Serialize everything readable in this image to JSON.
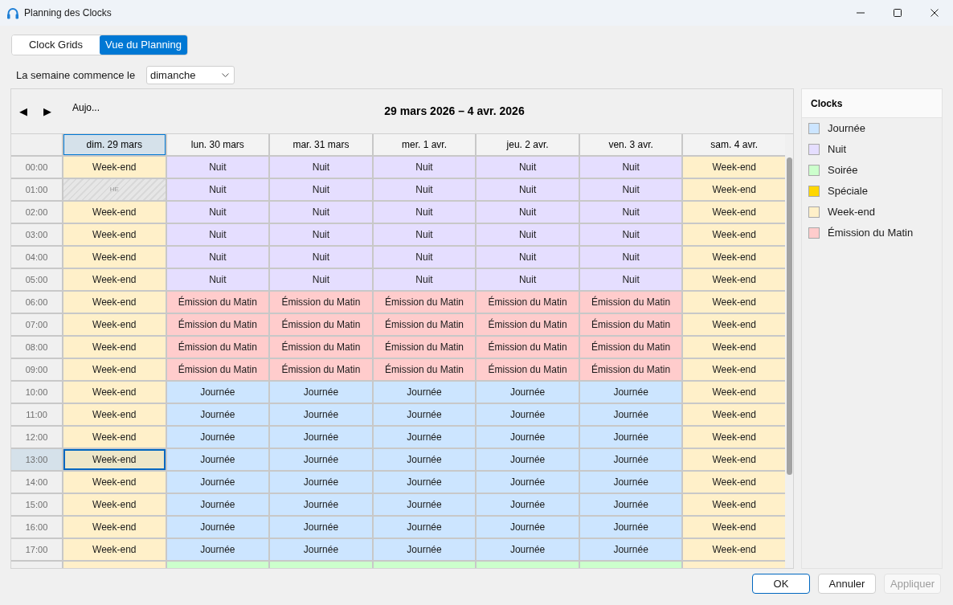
{
  "window": {
    "title": "Planning des Clocks"
  },
  "tabs": [
    {
      "label": "Clock Grids",
      "selected": false
    },
    {
      "label": "Vue du Planning",
      "selected": true
    }
  ],
  "week_start": {
    "label": "La semaine commence le",
    "value": "dimanche"
  },
  "calendar": {
    "prev_button": "◀",
    "next_button": "▶",
    "today_button": "Aujo...",
    "range_title": "29 mars 2026 – 4 avr. 2026",
    "days": [
      {
        "label": "dim. 29 mars",
        "selected": true
      },
      {
        "label": "lun. 30 mars",
        "selected": false
      },
      {
        "label": "mar. 31 mars",
        "selected": false
      },
      {
        "label": "mer. 1 avr.",
        "selected": false
      },
      {
        "label": "jeu. 2 avr.",
        "selected": false
      },
      {
        "label": "ven. 3 avr.",
        "selected": false
      },
      {
        "label": "sam. 4 avr.",
        "selected": false
      }
    ],
    "rows": [
      {
        "time": "00:00",
        "selected": false,
        "cells": [
          {
            "kind": "clock",
            "label": "Week-end",
            "color": "#fff0c9",
            "selected": false
          },
          {
            "kind": "clock",
            "label": "Nuit",
            "color": "#e5deff",
            "selected": false
          },
          {
            "kind": "clock",
            "label": "Nuit",
            "color": "#e5deff",
            "selected": false
          },
          {
            "kind": "clock",
            "label": "Nuit",
            "color": "#e5deff",
            "selected": false
          },
          {
            "kind": "clock",
            "label": "Nuit",
            "color": "#e5deff",
            "selected": false
          },
          {
            "kind": "clock",
            "label": "Nuit",
            "color": "#e5deff",
            "selected": false
          },
          {
            "kind": "clock",
            "label": "Week-end",
            "color": "#fff0c9",
            "selected": false
          }
        ]
      },
      {
        "time": "01:00",
        "selected": false,
        "cells": [
          {
            "kind": "empty",
            "label": "HE",
            "selected": false
          },
          {
            "kind": "clock",
            "label": "Nuit",
            "color": "#e5deff",
            "selected": false
          },
          {
            "kind": "clock",
            "label": "Nuit",
            "color": "#e5deff",
            "selected": false
          },
          {
            "kind": "clock",
            "label": "Nuit",
            "color": "#e5deff",
            "selected": false
          },
          {
            "kind": "clock",
            "label": "Nuit",
            "color": "#e5deff",
            "selected": false
          },
          {
            "kind": "clock",
            "label": "Nuit",
            "color": "#e5deff",
            "selected": false
          },
          {
            "kind": "clock",
            "label": "Week-end",
            "color": "#fff0c9",
            "selected": false
          }
        ]
      },
      {
        "time": "02:00",
        "selected": false,
        "cells": [
          {
            "kind": "clock",
            "label": "Week-end",
            "color": "#fff0c9",
            "selected": false
          },
          {
            "kind": "clock",
            "label": "Nuit",
            "color": "#e5deff",
            "selected": false
          },
          {
            "kind": "clock",
            "label": "Nuit",
            "color": "#e5deff",
            "selected": false
          },
          {
            "kind": "clock",
            "label": "Nuit",
            "color": "#e5deff",
            "selected": false
          },
          {
            "kind": "clock",
            "label": "Nuit",
            "color": "#e5deff",
            "selected": false
          },
          {
            "kind": "clock",
            "label": "Nuit",
            "color": "#e5deff",
            "selected": false
          },
          {
            "kind": "clock",
            "label": "Week-end",
            "color": "#fff0c9",
            "selected": false
          }
        ]
      },
      {
        "time": "03:00",
        "selected": false,
        "cells": [
          {
            "kind": "clock",
            "label": "Week-end",
            "color": "#fff0c9",
            "selected": false
          },
          {
            "kind": "clock",
            "label": "Nuit",
            "color": "#e5deff",
            "selected": false
          },
          {
            "kind": "clock",
            "label": "Nuit",
            "color": "#e5deff",
            "selected": false
          },
          {
            "kind": "clock",
            "label": "Nuit",
            "color": "#e5deff",
            "selected": false
          },
          {
            "kind": "clock",
            "label": "Nuit",
            "color": "#e5deff",
            "selected": false
          },
          {
            "kind": "clock",
            "label": "Nuit",
            "color": "#e5deff",
            "selected": false
          },
          {
            "kind": "clock",
            "label": "Week-end",
            "color": "#fff0c9",
            "selected": false
          }
        ]
      },
      {
        "time": "04:00",
        "selected": false,
        "cells": [
          {
            "kind": "clock",
            "label": "Week-end",
            "color": "#fff0c9",
            "selected": false
          },
          {
            "kind": "clock",
            "label": "Nuit",
            "color": "#e5deff",
            "selected": false
          },
          {
            "kind": "clock",
            "label": "Nuit",
            "color": "#e5deff",
            "selected": false
          },
          {
            "kind": "clock",
            "label": "Nuit",
            "color": "#e5deff",
            "selected": false
          },
          {
            "kind": "clock",
            "label": "Nuit",
            "color": "#e5deff",
            "selected": false
          },
          {
            "kind": "clock",
            "label": "Nuit",
            "color": "#e5deff",
            "selected": false
          },
          {
            "kind": "clock",
            "label": "Week-end",
            "color": "#fff0c9",
            "selected": false
          }
        ]
      },
      {
        "time": "05:00",
        "selected": false,
        "cells": [
          {
            "kind": "clock",
            "label": "Week-end",
            "color": "#fff0c9",
            "selected": false
          },
          {
            "kind": "clock",
            "label": "Nuit",
            "color": "#e5deff",
            "selected": false
          },
          {
            "kind": "clock",
            "label": "Nuit",
            "color": "#e5deff",
            "selected": false
          },
          {
            "kind": "clock",
            "label": "Nuit",
            "color": "#e5deff",
            "selected": false
          },
          {
            "kind": "clock",
            "label": "Nuit",
            "color": "#e5deff",
            "selected": false
          },
          {
            "kind": "clock",
            "label": "Nuit",
            "color": "#e5deff",
            "selected": false
          },
          {
            "kind": "clock",
            "label": "Week-end",
            "color": "#fff0c9",
            "selected": false
          }
        ]
      },
      {
        "time": "06:00",
        "selected": false,
        "cells": [
          {
            "kind": "clock",
            "label": "Week-end",
            "color": "#fff0c9",
            "selected": false
          },
          {
            "kind": "clock",
            "label": "Émission du Matin",
            "color": "#ffcccc",
            "selected": false
          },
          {
            "kind": "clock",
            "label": "Émission du Matin",
            "color": "#ffcccc",
            "selected": false
          },
          {
            "kind": "clock",
            "label": "Émission du Matin",
            "color": "#ffcccc",
            "selected": false
          },
          {
            "kind": "clock",
            "label": "Émission du Matin",
            "color": "#ffcccc",
            "selected": false
          },
          {
            "kind": "clock",
            "label": "Émission du Matin",
            "color": "#ffcccc",
            "selected": false
          },
          {
            "kind": "clock",
            "label": "Week-end",
            "color": "#fff0c9",
            "selected": false
          }
        ]
      },
      {
        "time": "07:00",
        "selected": false,
        "cells": [
          {
            "kind": "clock",
            "label": "Week-end",
            "color": "#fff0c9",
            "selected": false
          },
          {
            "kind": "clock",
            "label": "Émission du Matin",
            "color": "#ffcccc",
            "selected": false
          },
          {
            "kind": "clock",
            "label": "Émission du Matin",
            "color": "#ffcccc",
            "selected": false
          },
          {
            "kind": "clock",
            "label": "Émission du Matin",
            "color": "#ffcccc",
            "selected": false
          },
          {
            "kind": "clock",
            "label": "Émission du Matin",
            "color": "#ffcccc",
            "selected": false
          },
          {
            "kind": "clock",
            "label": "Émission du Matin",
            "color": "#ffcccc",
            "selected": false
          },
          {
            "kind": "clock",
            "label": "Week-end",
            "color": "#fff0c9",
            "selected": false
          }
        ]
      },
      {
        "time": "08:00",
        "selected": false,
        "cells": [
          {
            "kind": "clock",
            "label": "Week-end",
            "color": "#fff0c9",
            "selected": false
          },
          {
            "kind": "clock",
            "label": "Émission du Matin",
            "color": "#ffcccc",
            "selected": false
          },
          {
            "kind": "clock",
            "label": "Émission du Matin",
            "color": "#ffcccc",
            "selected": false
          },
          {
            "kind": "clock",
            "label": "Émission du Matin",
            "color": "#ffcccc",
            "selected": false
          },
          {
            "kind": "clock",
            "label": "Émission du Matin",
            "color": "#ffcccc",
            "selected": false
          },
          {
            "kind": "clock",
            "label": "Émission du Matin",
            "color": "#ffcccc",
            "selected": false
          },
          {
            "kind": "clock",
            "label": "Week-end",
            "color": "#fff0c9",
            "selected": false
          }
        ]
      },
      {
        "time": "09:00",
        "selected": false,
        "cells": [
          {
            "kind": "clock",
            "label": "Week-end",
            "color": "#fff0c9",
            "selected": false
          },
          {
            "kind": "clock",
            "label": "Émission du Matin",
            "color": "#ffcccc",
            "selected": false
          },
          {
            "kind": "clock",
            "label": "Émission du Matin",
            "color": "#ffcccc",
            "selected": false
          },
          {
            "kind": "clock",
            "label": "Émission du Matin",
            "color": "#ffcccc",
            "selected": false
          },
          {
            "kind": "clock",
            "label": "Émission du Matin",
            "color": "#ffcccc",
            "selected": false
          },
          {
            "kind": "clock",
            "label": "Émission du Matin",
            "color": "#ffcccc",
            "selected": false
          },
          {
            "kind": "clock",
            "label": "Week-end",
            "color": "#fff0c9",
            "selected": false
          }
        ]
      },
      {
        "time": "10:00",
        "selected": false,
        "cells": [
          {
            "kind": "clock",
            "label": "Week-end",
            "color": "#fff0c9",
            "selected": false
          },
          {
            "kind": "clock",
            "label": "Journée",
            "color": "#cce5ff",
            "selected": false
          },
          {
            "kind": "clock",
            "label": "Journée",
            "color": "#cce5ff",
            "selected": false
          },
          {
            "kind": "clock",
            "label": "Journée",
            "color": "#cce5ff",
            "selected": false
          },
          {
            "kind": "clock",
            "label": "Journée",
            "color": "#cce5ff",
            "selected": false
          },
          {
            "kind": "clock",
            "label": "Journée",
            "color": "#cce5ff",
            "selected": false
          },
          {
            "kind": "clock",
            "label": "Week-end",
            "color": "#fff0c9",
            "selected": false
          }
        ]
      },
      {
        "time": "11:00",
        "selected": false,
        "cells": [
          {
            "kind": "clock",
            "label": "Week-end",
            "color": "#fff0c9",
            "selected": false
          },
          {
            "kind": "clock",
            "label": "Journée",
            "color": "#cce5ff",
            "selected": false
          },
          {
            "kind": "clock",
            "label": "Journée",
            "color": "#cce5ff",
            "selected": false
          },
          {
            "kind": "clock",
            "label": "Journée",
            "color": "#cce5ff",
            "selected": false
          },
          {
            "kind": "clock",
            "label": "Journée",
            "color": "#cce5ff",
            "selected": false
          },
          {
            "kind": "clock",
            "label": "Journée",
            "color": "#cce5ff",
            "selected": false
          },
          {
            "kind": "clock",
            "label": "Week-end",
            "color": "#fff0c9",
            "selected": false
          }
        ]
      },
      {
        "time": "12:00",
        "selected": false,
        "cells": [
          {
            "kind": "clock",
            "label": "Week-end",
            "color": "#fff0c9",
            "selected": false
          },
          {
            "kind": "clock",
            "label": "Journée",
            "color": "#cce5ff",
            "selected": false
          },
          {
            "kind": "clock",
            "label": "Journée",
            "color": "#cce5ff",
            "selected": false
          },
          {
            "kind": "clock",
            "label": "Journée",
            "color": "#cce5ff",
            "selected": false
          },
          {
            "kind": "clock",
            "label": "Journée",
            "color": "#cce5ff",
            "selected": false
          },
          {
            "kind": "clock",
            "label": "Journée",
            "color": "#cce5ff",
            "selected": false
          },
          {
            "kind": "clock",
            "label": "Week-end",
            "color": "#fff0c9",
            "selected": false
          }
        ]
      },
      {
        "time": "13:00",
        "selected": true,
        "cells": [
          {
            "kind": "clock",
            "label": "Week-end",
            "color": "#ede7c9",
            "selected": true
          },
          {
            "kind": "clock",
            "label": "Journée",
            "color": "#cce5ff",
            "selected": false
          },
          {
            "kind": "clock",
            "label": "Journée",
            "color": "#cce5ff",
            "selected": false
          },
          {
            "kind": "clock",
            "label": "Journée",
            "color": "#cce5ff",
            "selected": false
          },
          {
            "kind": "clock",
            "label": "Journée",
            "color": "#cce5ff",
            "selected": false
          },
          {
            "kind": "clock",
            "label": "Journée",
            "color": "#cce5ff",
            "selected": false
          },
          {
            "kind": "clock",
            "label": "Week-end",
            "color": "#fff0c9",
            "selected": false
          }
        ]
      },
      {
        "time": "14:00",
        "selected": false,
        "cells": [
          {
            "kind": "clock",
            "label": "Week-end",
            "color": "#fff0c9",
            "selected": false
          },
          {
            "kind": "clock",
            "label": "Journée",
            "color": "#cce5ff",
            "selected": false
          },
          {
            "kind": "clock",
            "label": "Journée",
            "color": "#cce5ff",
            "selected": false
          },
          {
            "kind": "clock",
            "label": "Journée",
            "color": "#cce5ff",
            "selected": false
          },
          {
            "kind": "clock",
            "label": "Journée",
            "color": "#cce5ff",
            "selected": false
          },
          {
            "kind": "clock",
            "label": "Journée",
            "color": "#cce5ff",
            "selected": false
          },
          {
            "kind": "clock",
            "label": "Week-end",
            "color": "#fff0c9",
            "selected": false
          }
        ]
      },
      {
        "time": "15:00",
        "selected": false,
        "cells": [
          {
            "kind": "clock",
            "label": "Week-end",
            "color": "#fff0c9",
            "selected": false
          },
          {
            "kind": "clock",
            "label": "Journée",
            "color": "#cce5ff",
            "selected": false
          },
          {
            "kind": "clock",
            "label": "Journée",
            "color": "#cce5ff",
            "selected": false
          },
          {
            "kind": "clock",
            "label": "Journée",
            "color": "#cce5ff",
            "selected": false
          },
          {
            "kind": "clock",
            "label": "Journée",
            "color": "#cce5ff",
            "selected": false
          },
          {
            "kind": "clock",
            "label": "Journée",
            "color": "#cce5ff",
            "selected": false
          },
          {
            "kind": "clock",
            "label": "Week-end",
            "color": "#fff0c9",
            "selected": false
          }
        ]
      },
      {
        "time": "16:00",
        "selected": false,
        "cells": [
          {
            "kind": "clock",
            "label": "Week-end",
            "color": "#fff0c9",
            "selected": false
          },
          {
            "kind": "clock",
            "label": "Journée",
            "color": "#cce5ff",
            "selected": false
          },
          {
            "kind": "clock",
            "label": "Journée",
            "color": "#cce5ff",
            "selected": false
          },
          {
            "kind": "clock",
            "label": "Journée",
            "color": "#cce5ff",
            "selected": false
          },
          {
            "kind": "clock",
            "label": "Journée",
            "color": "#cce5ff",
            "selected": false
          },
          {
            "kind": "clock",
            "label": "Journée",
            "color": "#cce5ff",
            "selected": false
          },
          {
            "kind": "clock",
            "label": "Week-end",
            "color": "#fff0c9",
            "selected": false
          }
        ]
      },
      {
        "time": "17:00",
        "selected": false,
        "cells": [
          {
            "kind": "clock",
            "label": "Week-end",
            "color": "#fff0c9",
            "selected": false
          },
          {
            "kind": "clock",
            "label": "Journée",
            "color": "#cce5ff",
            "selected": false
          },
          {
            "kind": "clock",
            "label": "Journée",
            "color": "#cce5ff",
            "selected": false
          },
          {
            "kind": "clock",
            "label": "Journée",
            "color": "#cce5ff",
            "selected": false
          },
          {
            "kind": "clock",
            "label": "Journée",
            "color": "#cce5ff",
            "selected": false
          },
          {
            "kind": "clock",
            "label": "Journée",
            "color": "#cce5ff",
            "selected": false
          },
          {
            "kind": "clock",
            "label": "Week-end",
            "color": "#fff0c9",
            "selected": false
          }
        ]
      },
      {
        "cells": [
          {
            "kind": "clock",
            "color": "#fff0c9",
            "selected": false
          },
          {
            "kind": "clock",
            "color": "#ccffcc",
            "selected": false
          },
          {
            "kind": "clock",
            "color": "#ccffcc",
            "selected": false
          },
          {
            "kind": "clock",
            "color": "#ccffcc",
            "selected": false
          },
          {
            "kind": "clock",
            "color": "#ccffcc",
            "selected": false
          },
          {
            "kind": "clock",
            "color": "#ccffcc",
            "selected": false
          },
          {
            "kind": "clock",
            "color": "#fff0c9",
            "selected": false
          }
        ]
      }
    ]
  },
  "legend": {
    "title": "Clocks",
    "items": [
      {
        "label": "Journée",
        "color": "#cce5ff"
      },
      {
        "label": "Nuit",
        "color": "#e5deff"
      },
      {
        "label": "Soirée",
        "color": "#ccffcc"
      },
      {
        "label": "Spéciale",
        "color": "#ffd700"
      },
      {
        "label": "Week-end",
        "color": "#fff0c9"
      },
      {
        "label": "Émission du Matin",
        "color": "#ffcccc"
      }
    ]
  },
  "buttons": [
    {
      "label": "OK",
      "default": true,
      "disabled": false
    },
    {
      "label": "Annuler",
      "default": false,
      "disabled": false
    },
    {
      "label": "Appliquer",
      "default": false,
      "disabled": true
    }
  ]
}
